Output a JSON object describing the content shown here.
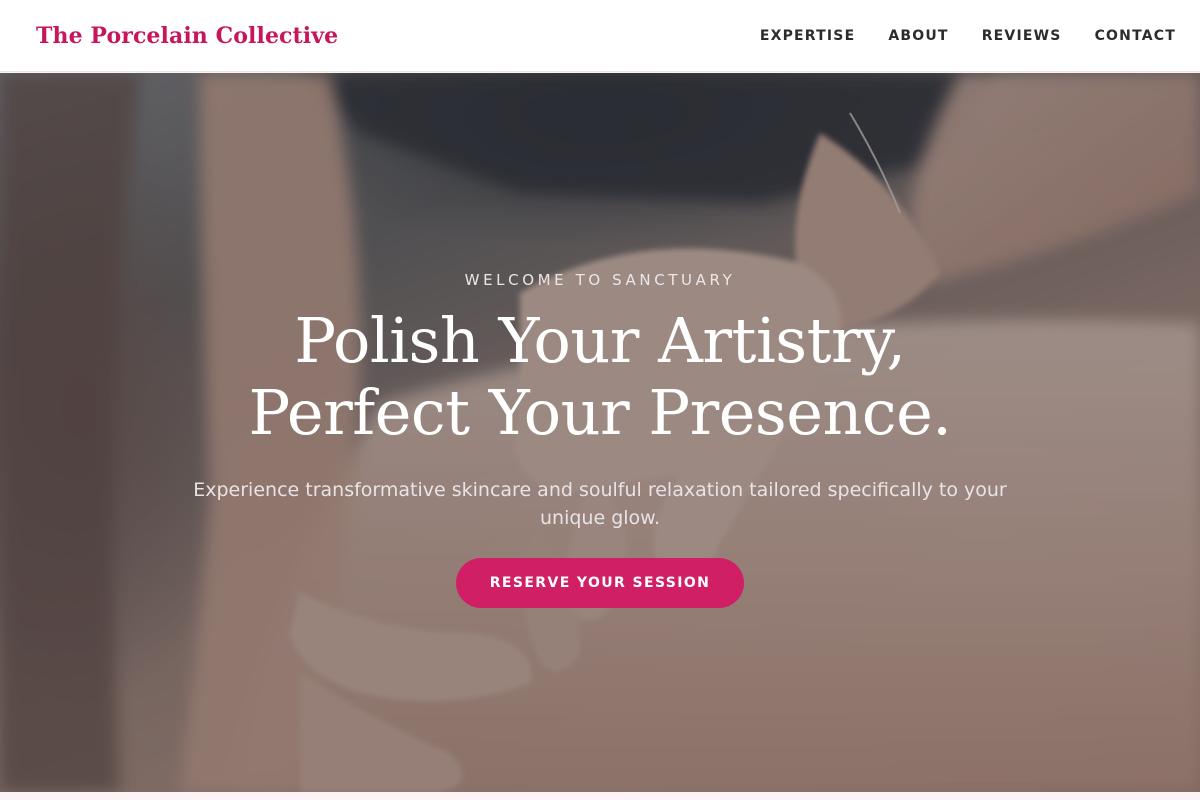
{
  "header": {
    "brand": "The Porcelain Collective",
    "nav": [
      "EXPERTISE",
      "ABOUT",
      "REVIEWS",
      "CONTACT"
    ]
  },
  "hero": {
    "eyebrow": "WELCOME TO SANCTUARY",
    "headline_line1": "Polish Your Artistry,",
    "headline_line2": "Perfect Your Presence.",
    "subtext": "Experience transformative skincare and soulful relaxation tailored specifically to your unique glow.",
    "cta_label": "RESERVE YOUR SESSION",
    "background_image": "massage-hands-photo"
  },
  "colors": {
    "accent": "#d11f65",
    "brand": "#c7175c",
    "nav_text": "#2c2c2c",
    "header_bg": "#ffffff",
    "page_bg": "#fdf3f7"
  }
}
